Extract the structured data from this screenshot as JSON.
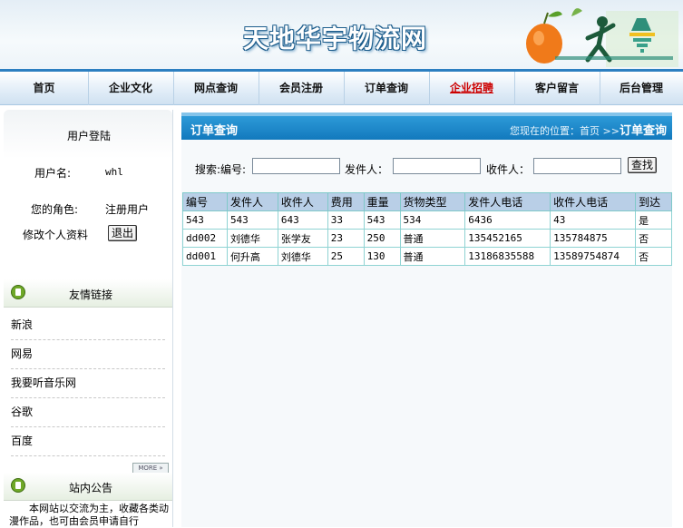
{
  "header": {
    "site_title": "天地华宇物流网"
  },
  "nav": {
    "items": [
      "首页",
      "企业文化",
      "网点查询",
      "会员注册",
      "订单查询",
      "企业招聘",
      "客户留言",
      "后台管理"
    ]
  },
  "login": {
    "title": "用户登陆",
    "username_label": "用户名:",
    "username_value": "whl",
    "role_label": "您的角色:",
    "role_value": "注册用户",
    "edit_profile": "修改个人资料",
    "logout": "退出"
  },
  "links": {
    "title": "友情链接",
    "items": [
      "新浪",
      "网易",
      "我要听音乐网",
      "谷歌",
      "百度"
    ],
    "more": "MORE »"
  },
  "notice": {
    "title": "站内公告",
    "text": "本网站以交流为主，收藏各类动漫作品，也可由会员申请自行"
  },
  "main": {
    "title": "订单查询",
    "breadcrumb_prefix": "您现在的位置：首页 >>",
    "breadcrumb_current": "订单查询"
  },
  "search": {
    "label_prefix": "搜索:编号:",
    "order_no_value": "",
    "sender_label": "发件人：",
    "sender_value": "",
    "receiver_label": "收件人：",
    "receiver_value": "",
    "button": "查找"
  },
  "table": {
    "columns": [
      "编号",
      "发件人",
      "收件人",
      "费用",
      "重量",
      "货物类型",
      "发件人电话",
      "收件人电话",
      "到达"
    ],
    "rows": [
      [
        "543",
        "543",
        "643",
        "33",
        "543",
        "534",
        "6436",
        "43",
        "是"
      ],
      [
        "dd002",
        "刘德华",
        "张学友",
        "23",
        "250",
        "普通",
        "135452165",
        "135784875",
        "否"
      ],
      [
        "dd001",
        "何升高",
        "刘德华",
        "25",
        "130",
        "普通",
        "13186835588",
        "13589754874",
        "否"
      ]
    ]
  },
  "colors": {
    "accent": "#1279bd",
    "nav_border": "#2c7fc1",
    "table_header": "#b9cfe7",
    "table_border": "#8fd3d3",
    "hot_nav": "#cc0000",
    "section_icon": "#6fa828"
  }
}
